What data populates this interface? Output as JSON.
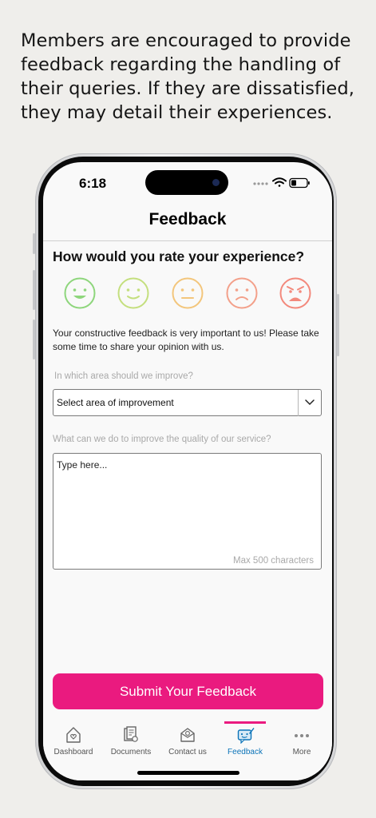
{
  "promo": {
    "text": "Members are encouraged to provide feedback regarding the handling of their queries. If they are dissatisfied, they may detail their experiences."
  },
  "status_bar": {
    "time": "6:18"
  },
  "header": {
    "title": "Feedback"
  },
  "rating": {
    "question": "How would you rate your experience?",
    "faces": [
      {
        "icon": "very-happy-face-icon",
        "color": "#8ed67c"
      },
      {
        "icon": "happy-face-icon",
        "color": "#c4df7e"
      },
      {
        "icon": "neutral-face-icon",
        "color": "#f3c67c"
      },
      {
        "icon": "sad-face-icon",
        "color": "#f3a08a"
      },
      {
        "icon": "angry-face-icon",
        "color": "#f3897c"
      }
    ]
  },
  "intro": "Your constructive feedback is very important to us! Please take some time to share your opinion with us.",
  "improve_area": {
    "label": "In which area should we improve?",
    "selected": "Select area of improvement"
  },
  "service_input": {
    "label": "What can we do to improve the quality of our service?",
    "placeholder": "Type here...",
    "counter": "Max 500 characters"
  },
  "submit_label": "Submit Your Feedback",
  "tabs": [
    {
      "label": "Dashboard",
      "icon": "home-heart-icon"
    },
    {
      "label": "Documents",
      "icon": "documents-icon"
    },
    {
      "label": "Contact us",
      "icon": "mail-contact-icon"
    },
    {
      "label": "Feedback",
      "icon": "feedback-icon",
      "active": true
    },
    {
      "label": "More",
      "icon": "more-dots-icon"
    }
  ],
  "colors": {
    "accent": "#ea1a7f",
    "active_tab": "#0b73b8"
  }
}
